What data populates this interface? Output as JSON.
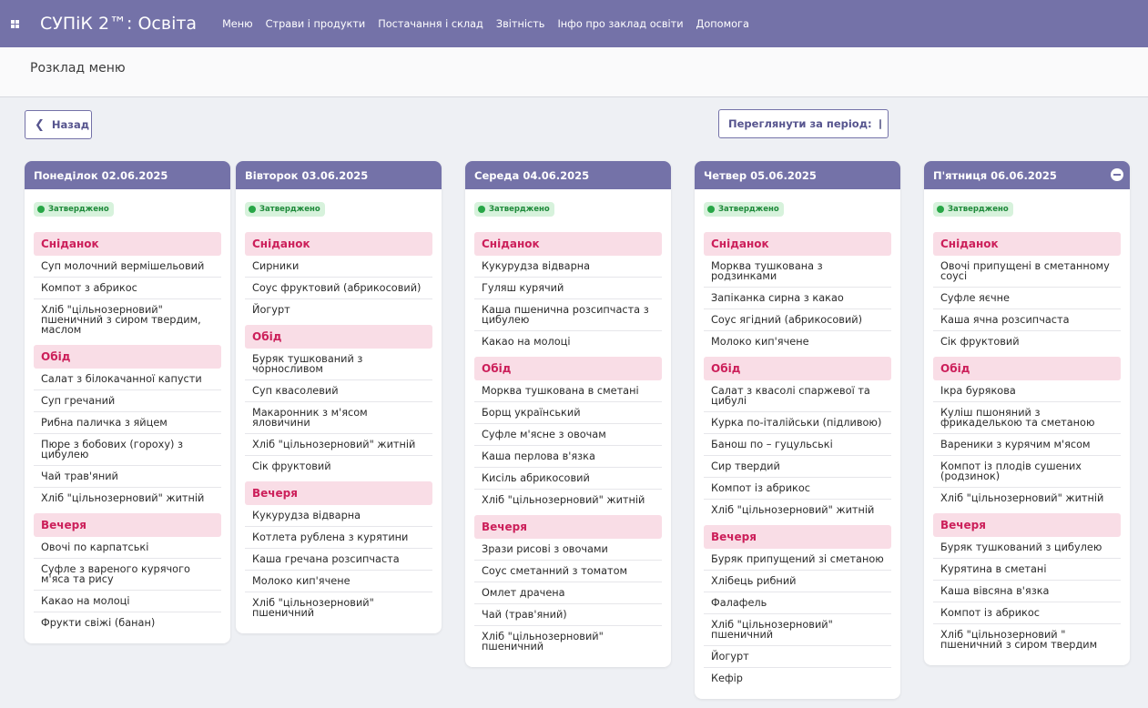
{
  "app": {
    "title": "СУПіК 2™: Освіта",
    "nav": [
      "Меню",
      "Страви і продукти",
      "Постачання і склад",
      "Звітність",
      "Інфо про заклад освіти",
      "Допомога"
    ]
  },
  "page": {
    "title": "Розклад меню",
    "back_label": "Назад",
    "period_label": "Переглянути за період:"
  },
  "colors": {
    "header": "#7472a8",
    "meal_bg": "#f9dde6",
    "meal_text": "#cc1f5a",
    "badge_bg": "#d7f2dc",
    "badge_text": "#1e8a3a"
  },
  "days": [
    {
      "title": "Понеділок 02.06.2025",
      "status": "Затверджено",
      "meals": [
        {
          "name": "Сніданок",
          "dishes": [
            "Суп молочний вермішельовий",
            "Компот з абрикос",
            "Хліб \"цільнозерновий\" пшеничний з сиром твердим, маслом"
          ]
        },
        {
          "name": "Обід",
          "dishes": [
            "Салат з білокачанної капусти",
            "Суп гречаний",
            "Рибна паличка з яйцем",
            "Пюре з бобових (гороху) з цибулею",
            "Чай трав'яний",
            "Хліб \"цільнозерновий\" житній"
          ]
        },
        {
          "name": "Вечеря",
          "dishes": [
            "Овочі по карпатські",
            "Суфле з вареного курячого м'яса та рису",
            "Какао на молоці",
            "Фрукти свіжі (банан)"
          ]
        }
      ]
    },
    {
      "title": "Вівторок 03.06.2025",
      "status": "Затверджено",
      "meals": [
        {
          "name": "Сніданок",
          "dishes": [
            "Сирники",
            "Соус фруктовий (абрикосовий)",
            "Йогурт"
          ]
        },
        {
          "name": "Обід",
          "dishes": [
            "Буряк тушкований з чорносливом",
            "Суп квасолевий",
            "Макаронник з м'ясом яловичини",
            "Хліб \"цільнозерновий\" житній",
            "Сік фруктовий"
          ]
        },
        {
          "name": "Вечеря",
          "dishes": [
            "Кукурудза відварна",
            "Котлета рублена з курятини",
            "Каша гречана розсипчаста",
            "Молоко кип'ячене",
            "Хліб \"цільнозерновий\" пшеничний"
          ]
        }
      ]
    },
    {
      "title": "Середа 04.06.2025",
      "status": "Затверджено",
      "meals": [
        {
          "name": "Сніданок",
          "dishes": [
            "Кукурудза відварна",
            "Гуляш курячий",
            "Каша пшенична розсипчаста з цибулею",
            "Какао на молоці"
          ]
        },
        {
          "name": "Обід",
          "dishes": [
            "Морква тушкована в сметані",
            "Борщ український",
            "Суфле м'ясне з овочам",
            "Каша перлова в'язка",
            "Кисіль абрикосовий",
            "Хліб \"цільнозерновий\" житній"
          ]
        },
        {
          "name": "Вечеря",
          "dishes": [
            "Зрази рисові з овочами",
            "Соус сметанний з томатом",
            "Омлет драчена",
            "Чай (трав'яний)",
            "Хліб \"цільнозерновий\" пшеничний"
          ]
        }
      ]
    },
    {
      "title": "Четвер 05.06.2025",
      "status": "Затверджено",
      "meals": [
        {
          "name": "Сніданок",
          "dishes": [
            "Морква тушкована з родзинками",
            "Запіканка сирна з какао",
            "Соус ягідний (абрикосовий)",
            "Молоко кип'ячене"
          ]
        },
        {
          "name": "Обід",
          "dishes": [
            "Салат з квасолі спаржевої та цибулі",
            "Курка по-італійськи (підливою)",
            "Банош по – гуцульські",
            "Сир твердий",
            "Компот із абрикос",
            "Хліб \"цільнозерновий\" житній"
          ]
        },
        {
          "name": "Вечеря",
          "dishes": [
            "Буряк припущений зі сметаною",
            "Хлібець рибний",
            "Фалафель",
            "Хліб \"цільнозерновий\" пшеничний",
            "Йогурт",
            "Кефір"
          ]
        }
      ]
    },
    {
      "title": "П'ятниця 06.06.2025",
      "status": "Затверджено",
      "meals": [
        {
          "name": "Сніданок",
          "dishes": [
            "Овочі припущені в сметанному соусі",
            "Суфле яєчне",
            "Каша ячна розсипчаста",
            "Сік фруктовий"
          ]
        },
        {
          "name": "Обід",
          "dishes": [
            "Ікра бурякова",
            "Куліш пшоняний з фрикаделькою та сметаною",
            "Вареники з курячим м'ясом",
            "Компот із плодів сушених (родзинок)",
            "Хліб \"цільнозерновий\" житній"
          ]
        },
        {
          "name": "Вечеря",
          "dishes": [
            "Буряк тушкований з цибулею",
            "Курятина в сметані",
            "Каша вівсяна в'язка",
            "Компот із абрикос",
            "Хліб \"цільнозерновий \" пшеничний з сиром твердим"
          ]
        }
      ]
    }
  ]
}
